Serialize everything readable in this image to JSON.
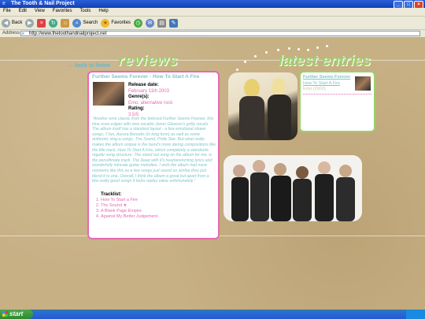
{
  "window": {
    "title": "The Tooth & Nail Project"
  },
  "menu": [
    "File",
    "Edit",
    "View",
    "Favorites",
    "Tools",
    "Help"
  ],
  "toolbar": {
    "back": "Back",
    "search": "Search",
    "favorites": "Favorites"
  },
  "address": {
    "label": "Address",
    "url": "http://www.thetoothandnailproject.net"
  },
  "page": {
    "back_link": "← back to home",
    "reviews_heading": "reviews",
    "latest_heading": "latest entries",
    "review": {
      "title": "Further Seems Forever - How To Start A Fire",
      "release_label": "Release date:",
      "release_value": "February 11th 2003",
      "genre_label": "Genre(s):",
      "genre_value": "Emo, alternative rock",
      "rating_label": "Rating:",
      "rating_value": "3.5/5",
      "text": "\"Another emo classic from the beloved Further Seems Forever, this time even edgier with new vocalist Jason Gleason's gritty vocals. The album itself has a standard layout - a few emotional slower songs, 7 fun, Aurora Borealis (in long form) as well as some anthemic sing-a songs. The Sound, Pride Star. But what really makes the album unique is the band's more daring compositions like the title track, How To Start A Fire, which completely a standards regular song structure. The stand out song on the album for me, is the penultimate track, The Deep with it's heartwrenching lyrics and wonderfully intricate guitar melodies. I wish the album had more moments like this as a few songs just sound so similar they just blend it to one. Overall, I think the album a great but apart from a few really good songs it lacks replay value unfortunately.\"",
      "tracklist_label": "Tracklist:",
      "tracks": [
        "How To Start a Fire",
        "The Sound ★",
        "A Blank Page Empire",
        "Against My Better Judgement"
      ]
    },
    "latest": {
      "title": "Further Seems Forever",
      "link": "How To Start A Fire",
      "date": "Emo (2003)"
    }
  },
  "taskbar": {
    "start": "start"
  },
  "colors": {
    "accent_pink": "#e66ab0",
    "accent_green": "#9bd06c",
    "accent_teal": "#7dc6c9"
  }
}
